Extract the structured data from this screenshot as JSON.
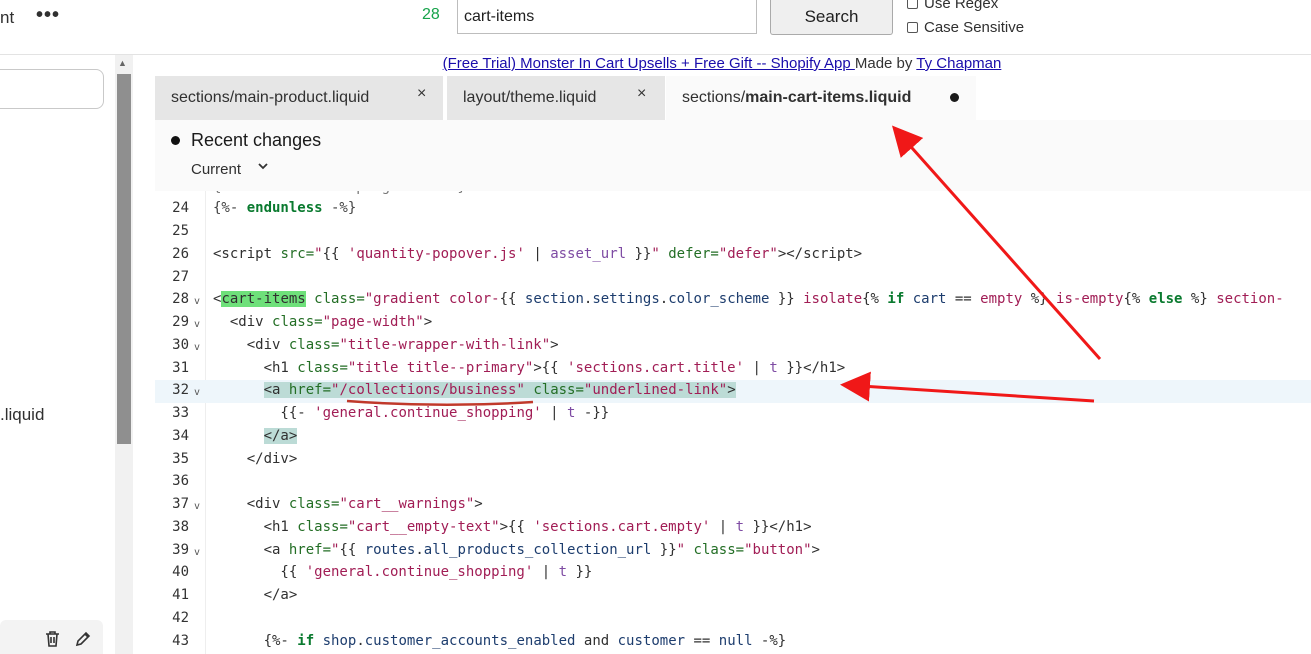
{
  "topbar": {
    "left_fragment": "nt",
    "more_icon": "more-horizontal-icon",
    "match_count": "28",
    "search_value": "cart-items",
    "search_button": "Search",
    "options": [
      {
        "label": "Use Regex",
        "checked": false
      },
      {
        "label": "Case Sensitive",
        "checked": false
      }
    ]
  },
  "left_panel": {
    "file_fragment": ".liquid",
    "icons": [
      "trash-icon",
      "edit-icon"
    ]
  },
  "app_link": {
    "link_text": "(Free Trial) Monster In Cart Upsells + Free Gift -- Shopify App ",
    "made_by": "Made by ",
    "author": "Ty Chapman"
  },
  "tabs": [
    {
      "prefix": "sections/main-product.liquid",
      "bold": "",
      "active": false,
      "close": "×"
    },
    {
      "prefix": "layout/theme.liquid",
      "bold": "",
      "active": false,
      "close": "×"
    },
    {
      "prefix": "sections/",
      "bold": "main-cart-items.liquid",
      "active": true,
      "unsaved": true
    }
  ],
  "recent_changes": {
    "title": "Recent changes",
    "selector": "Current"
  },
  "code": {
    "current_line": 32,
    "lines": [
      {
        "n": "24",
        "fold": false
      },
      {
        "n": "25",
        "fold": false
      },
      {
        "n": "26",
        "fold": false
      },
      {
        "n": "27",
        "fold": false
      },
      {
        "n": "28",
        "fold": true
      },
      {
        "n": "29",
        "fold": true
      },
      {
        "n": "30",
        "fold": true
      },
      {
        "n": "31",
        "fold": false
      },
      {
        "n": "32",
        "fold": true
      },
      {
        "n": "33",
        "fold": false
      },
      {
        "n": "34",
        "fold": false
      },
      {
        "n": "35",
        "fold": false
      },
      {
        "n": "36",
        "fold": false
      },
      {
        "n": "37",
        "fold": true
      },
      {
        "n": "38",
        "fold": false
      },
      {
        "n": "39",
        "fold": true
      },
      {
        "n": "40",
        "fold": false
      },
      {
        "n": "41",
        "fold": false
      },
      {
        "n": "42",
        "fold": false
      },
      {
        "n": "43",
        "fold": false
      }
    ]
  },
  "colors": {
    "annotation_red": "#f01818",
    "match_highlight": "#6ee07a",
    "selection_highlight": "#bcdbd6",
    "count_green": "#16a34a"
  }
}
